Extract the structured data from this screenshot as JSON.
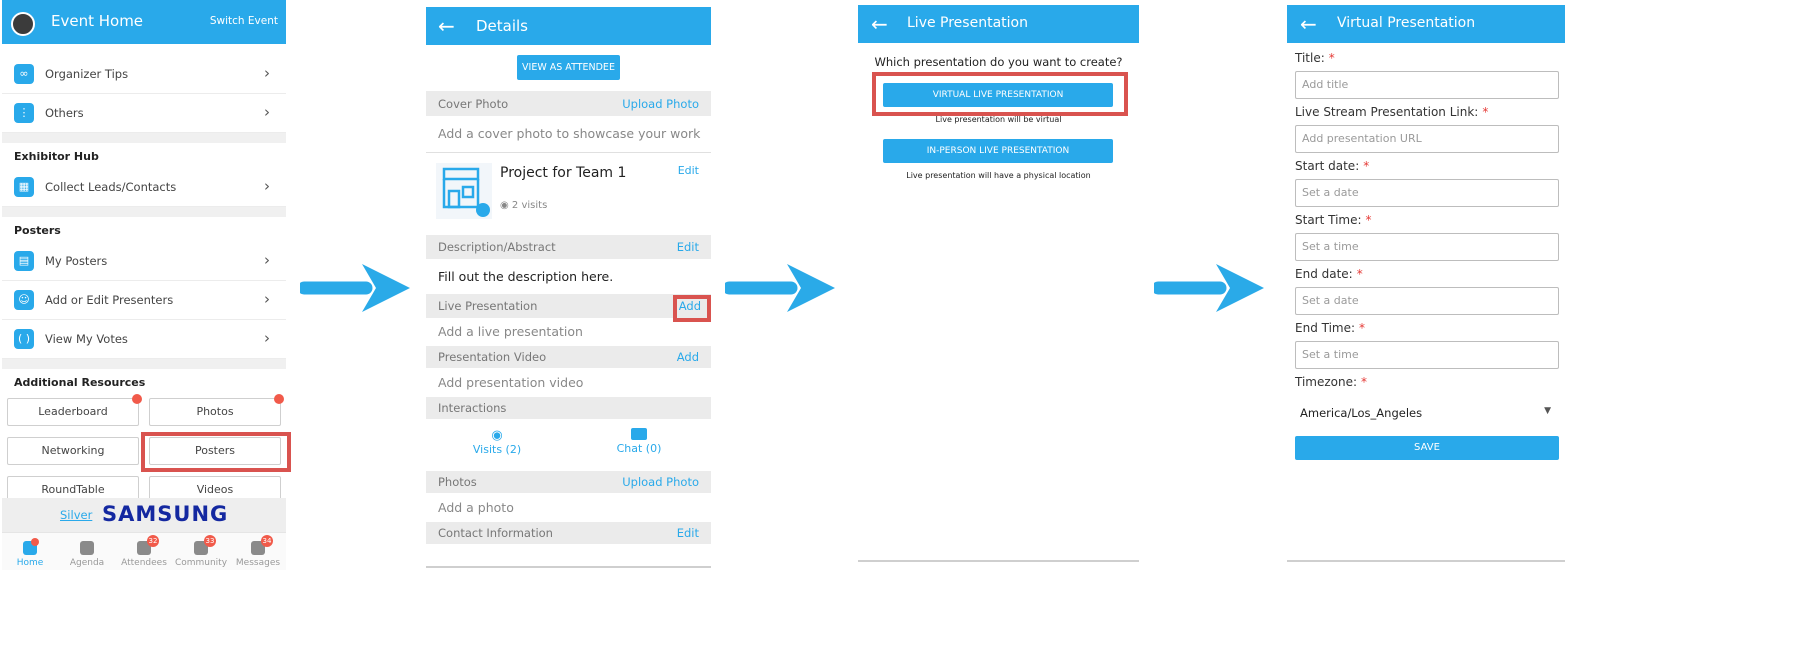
{
  "screen1": {
    "title": "Event Home",
    "switch": "Switch Event",
    "rows_top": [
      {
        "label": "Organizer Tips",
        "icon": "glasses-icon"
      },
      {
        "label": "Others",
        "icon": "more-vertical-icon"
      }
    ],
    "exhibitor_hub": "Exhibitor Hub",
    "collect_leads": "Collect Leads/Contacts",
    "posters_header": "Posters",
    "poster_rows": [
      {
        "label": "My Posters"
      },
      {
        "label": "Add or Edit Presenters"
      },
      {
        "label": "View My Votes"
      }
    ],
    "additional_resources": "Additional Resources",
    "grid": [
      "Leaderboard",
      "Photos",
      "Networking",
      "Posters",
      "RoundTable",
      "Videos"
    ],
    "sponsor_level": "Silver",
    "sponsor_logo": "SAMSUNG",
    "tabs": [
      {
        "label": "Home",
        "badge": ""
      },
      {
        "label": "Agenda",
        "badge": ""
      },
      {
        "label": "Attendees",
        "badge": "32"
      },
      {
        "label": "Community",
        "badge": "33"
      },
      {
        "label": "Messages",
        "badge": "34"
      }
    ]
  },
  "screen2": {
    "title": "Details",
    "view_as_attendee": "VIEW AS ATTENDEE",
    "cover_photo": "Cover Photo",
    "upload_photo": "Upload Photo",
    "cover_hint": "Add a cover photo to showcase your work",
    "project_title": "Project for Team 1",
    "visits": "2 visits",
    "edit": "Edit",
    "description": "Description/Abstract",
    "description_text": "Fill out the description here.",
    "live_presentation": "Live Presentation",
    "add": "Add",
    "live_hint": "Add a live presentation",
    "presentation_video": "Presentation Video",
    "video_hint": "Add presentation video",
    "interactions": "Interactions",
    "visits_btn": "Visits (2)",
    "chat_btn": "Chat (0)",
    "photos": "Photos",
    "photo_hint": "Add a photo",
    "contact": "Contact Information"
  },
  "screen3": {
    "title": "Live Presentation",
    "question": "Which presentation do you want to create?",
    "virtual_btn": "VIRTUAL LIVE PRESENTATION",
    "virtual_note": "Live presentation will be virtual",
    "inperson_btn": "IN-PERSON LIVE PRESENTATION",
    "inperson_note": "Live presentation will have a physical location"
  },
  "screen4": {
    "title": "Virtual Presentation",
    "fields": [
      {
        "label": "Title:",
        "placeholder": "Add title"
      },
      {
        "label": "Live Stream Presentation Link:",
        "placeholder": "Add presentation URL"
      },
      {
        "label": "Start date:",
        "placeholder": "Set a date"
      },
      {
        "label": "Start Time:",
        "placeholder": "Set a time"
      },
      {
        "label": "End date:",
        "placeholder": "Set a date"
      },
      {
        "label": "End Time:",
        "placeholder": "Set a time"
      }
    ],
    "timezone_label": "Timezone:",
    "timezone_value": "America/Los_Angeles",
    "save": "SAVE"
  },
  "colors": {
    "primary": "#29a9ea",
    "highlight": "#d9534f",
    "badge": "#f15a4a",
    "samsung": "#1428a0"
  }
}
